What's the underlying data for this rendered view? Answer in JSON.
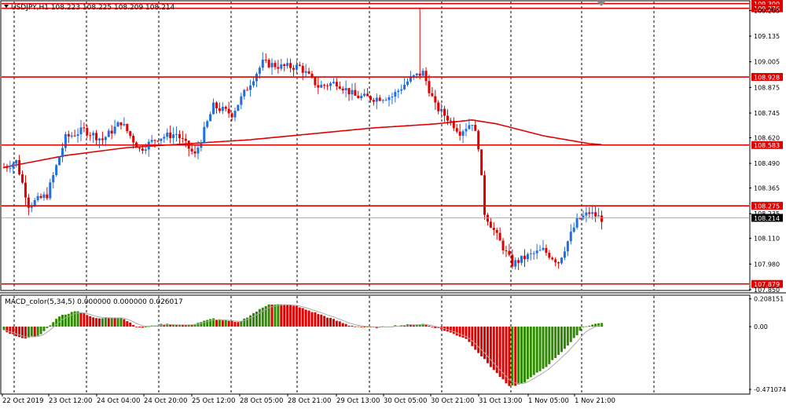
{
  "window": {
    "symbol_header": "USDJPY,H1  108.223 108.225 108.209 108.214",
    "macd_header": "MACD_color(5,34,5) 0.000000 0.000000 0.026017"
  },
  "colors": {
    "background": "#ffffff",
    "frame": "#000000",
    "bull_candle": "#1f6fe0",
    "bear_candle": "#e00000",
    "level_line": "#e00000",
    "ma_line": "#e00000",
    "macd_up": "#2e8b00",
    "macd_down": "#e00000",
    "signal_line": "#a9a9a9",
    "price_tag": "#e00000",
    "current_price_tag": "#000000"
  },
  "price_axis": {
    "ticks": [
      "109.265",
      "109.135",
      "109.005",
      "108.875",
      "108.745",
      "108.620",
      "108.490",
      "108.365",
      "108.235",
      "108.110",
      "107.980",
      "107.850"
    ],
    "levels": [
      {
        "label": "109.300",
        "value": 109.3
      },
      {
        "label": "109.276",
        "value": 109.276
      },
      {
        "label": "108.928",
        "value": 108.928
      },
      {
        "label": "108.583",
        "value": 108.583
      },
      {
        "label": "108.275",
        "value": 108.275
      },
      {
        "label": "107.879",
        "value": 107.879
      }
    ],
    "current": {
      "label": "108.214",
      "value": 108.214
    }
  },
  "macd_axis": {
    "ticks": [
      "0.208151",
      "0.00",
      "-0.471074"
    ]
  },
  "time_axis": {
    "labels": [
      "22 Oct 2019",
      "23 Oct 12:00",
      "24 Oct 04:00",
      "24 Oct 20:00",
      "25 Oct 12:00",
      "28 Oct 05:00",
      "28 Oct 21:00",
      "29 Oct 13:00",
      "30 Oct 05:00",
      "30 Oct 21:00",
      "31 Oct 13:00",
      "1 Nov 05:00",
      "1 Nov 21:00"
    ]
  },
  "chart_data": {
    "type": "candlestick",
    "symbol": "USDJPY",
    "timeframe": "H1",
    "y_range": [
      107.85,
      109.31
    ],
    "ohlc_anchors": [
      {
        "i": 0,
        "c": 108.47
      },
      {
        "i": 4,
        "c": 108.5
      },
      {
        "i": 8,
        "c": 108.28
      },
      {
        "i": 14,
        "c": 108.33
      },
      {
        "i": 20,
        "c": 108.62
      },
      {
        "i": 26,
        "c": 108.66
      },
      {
        "i": 32,
        "c": 108.61
      },
      {
        "i": 38,
        "c": 108.7
      },
      {
        "i": 44,
        "c": 108.56
      },
      {
        "i": 50,
        "c": 108.62
      },
      {
        "i": 56,
        "c": 108.64
      },
      {
        "i": 62,
        "c": 108.53
      },
      {
        "i": 68,
        "c": 108.78
      },
      {
        "i": 74,
        "c": 108.74
      },
      {
        "i": 80,
        "c": 108.9
      },
      {
        "i": 84,
        "c": 109.0
      },
      {
        "i": 90,
        "c": 108.98
      },
      {
        "i": 96,
        "c": 108.98
      },
      {
        "i": 102,
        "c": 108.88
      },
      {
        "i": 108,
        "c": 108.9
      },
      {
        "i": 114,
        "c": 108.83
      },
      {
        "i": 120,
        "c": 108.82
      },
      {
        "i": 126,
        "c": 108.83
      },
      {
        "i": 132,
        "c": 108.92
      },
      {
        "i": 136,
        "c": 108.95
      },
      {
        "i": 140,
        "c": 108.78
      },
      {
        "i": 144,
        "c": 108.72
      },
      {
        "i": 148,
        "c": 108.65
      },
      {
        "i": 152,
        "c": 108.7
      },
      {
        "i": 154,
        "c": 108.58
      },
      {
        "i": 156,
        "c": 108.24
      },
      {
        "i": 160,
        "c": 108.12
      },
      {
        "i": 165,
        "c": 107.98
      },
      {
        "i": 170,
        "c": 108.02
      },
      {
        "i": 175,
        "c": 108.05
      },
      {
        "i": 180,
        "c": 107.99
      },
      {
        "i": 186,
        "c": 108.2
      },
      {
        "i": 190,
        "c": 108.24
      },
      {
        "i": 194,
        "c": 108.21
      }
    ],
    "spike_high": {
      "i": 135,
      "h": 109.28
    },
    "moving_average": [
      {
        "i": 0,
        "v": 108.47
      },
      {
        "i": 20,
        "v": 108.53
      },
      {
        "i": 40,
        "v": 108.57
      },
      {
        "i": 60,
        "v": 108.59
      },
      {
        "i": 80,
        "v": 108.61
      },
      {
        "i": 100,
        "v": 108.64
      },
      {
        "i": 120,
        "v": 108.67
      },
      {
        "i": 140,
        "v": 108.69
      },
      {
        "i": 152,
        "v": 108.71
      },
      {
        "i": 160,
        "v": 108.69
      },
      {
        "i": 175,
        "v": 108.63
      },
      {
        "i": 190,
        "v": 108.59
      },
      {
        "i": 194,
        "v": 108.585
      }
    ],
    "macd_anchors": [
      {
        "i": 0,
        "v": -0.03
      },
      {
        "i": 6,
        "v": -0.09
      },
      {
        "i": 12,
        "v": -0.06
      },
      {
        "i": 18,
        "v": 0.08
      },
      {
        "i": 24,
        "v": 0.12
      },
      {
        "i": 30,
        "v": 0.06
      },
      {
        "i": 38,
        "v": 0.07
      },
      {
        "i": 44,
        "v": -0.01
      },
      {
        "i": 52,
        "v": 0.02
      },
      {
        "i": 60,
        "v": 0.01
      },
      {
        "i": 68,
        "v": 0.06
      },
      {
        "i": 76,
        "v": 0.03
      },
      {
        "i": 86,
        "v": 0.17
      },
      {
        "i": 94,
        "v": 0.16
      },
      {
        "i": 104,
        "v": 0.08
      },
      {
        "i": 112,
        "v": 0.01
      },
      {
        "i": 120,
        "v": -0.01
      },
      {
        "i": 128,
        "v": 0.01
      },
      {
        "i": 136,
        "v": 0.02
      },
      {
        "i": 142,
        "v": -0.02
      },
      {
        "i": 150,
        "v": -0.09
      },
      {
        "i": 158,
        "v": -0.3
      },
      {
        "i": 164,
        "v": -0.45
      },
      {
        "i": 168,
        "v": -0.43
      },
      {
        "i": 176,
        "v": -0.3
      },
      {
        "i": 184,
        "v": -0.12
      },
      {
        "i": 188,
        "v": 0.0
      },
      {
        "i": 194,
        "v": 0.03
      }
    ],
    "macd_range": [
      -0.5,
      0.23
    ]
  }
}
